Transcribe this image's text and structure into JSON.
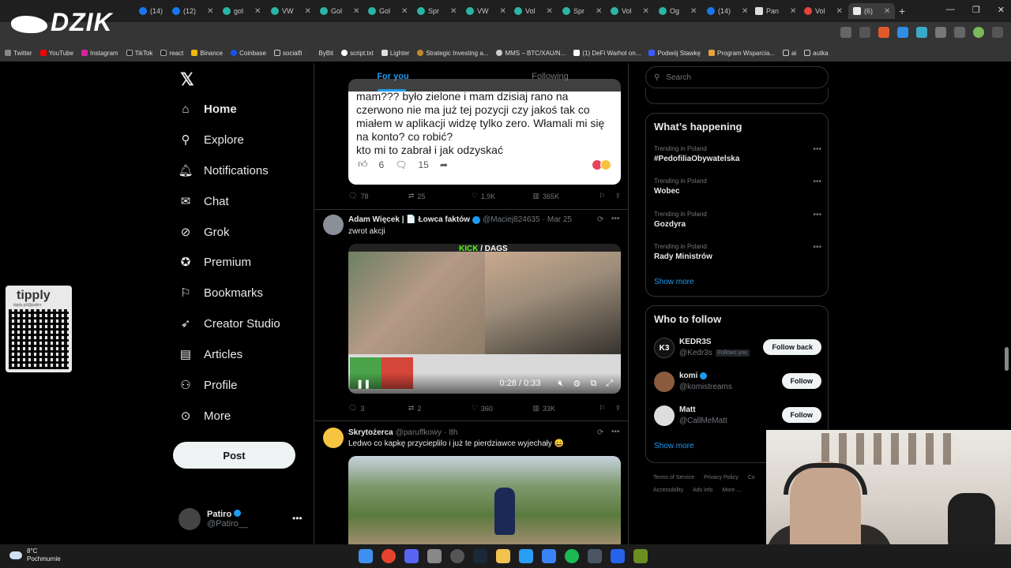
{
  "browser": {
    "tabs": [
      {
        "label": "(14)",
        "icon": "facebook-icon"
      },
      {
        "label": "(12)",
        "icon": "facebook-icon"
      },
      {
        "label": "gol",
        "icon": "site-icon"
      },
      {
        "label": "VW",
        "icon": "site-icon"
      },
      {
        "label": "Gol",
        "icon": "site-icon"
      },
      {
        "label": "Gol",
        "icon": "site-icon"
      },
      {
        "label": "Spr",
        "icon": "site-icon"
      },
      {
        "label": "VW",
        "icon": "site-icon"
      },
      {
        "label": "Vol",
        "icon": "site-icon"
      },
      {
        "label": "Spr",
        "icon": "site-icon"
      },
      {
        "label": "Vol",
        "icon": "site-icon"
      },
      {
        "label": "Og",
        "icon": "site-icon"
      },
      {
        "label": "(14)",
        "icon": "facebook-icon"
      },
      {
        "label": "Pan",
        "icon": "site-icon"
      },
      {
        "label": "Vol",
        "icon": "site-icon"
      },
      {
        "label": "(6)",
        "icon": "x-icon"
      }
    ],
    "bookmarks": [
      "Twitter",
      "YouTube",
      "Instagram",
      "TikTok",
      "react",
      "Binance",
      "Coinbase",
      "socialfi",
      "ByBit",
      "script.txt",
      "Lighter",
      "Strategic Investing a...",
      "MMS – BTC/XAU/N...",
      "(1) DeFi Warhol on...",
      "Podwój Stawkę",
      "Program Wsparcia...",
      "ai",
      "autka"
    ]
  },
  "overlay": {
    "logo_text": "DZIK",
    "tipply_title": "tipply",
    "tipply_url": "tipply.pl/@patiro"
  },
  "nav": {
    "items": [
      {
        "label": "Home",
        "icon": "home-icon"
      },
      {
        "label": "Explore",
        "icon": "search-icon"
      },
      {
        "label": "Notifications",
        "icon": "bell-icon"
      },
      {
        "label": "Chat",
        "icon": "mail-icon"
      },
      {
        "label": "Grok",
        "icon": "grok-icon"
      },
      {
        "label": "Premium",
        "icon": "premium-icon"
      },
      {
        "label": "Bookmarks",
        "icon": "bookmark-icon"
      },
      {
        "label": "Creator Studio",
        "icon": "rocket-icon"
      },
      {
        "label": "Articles",
        "icon": "article-icon"
      },
      {
        "label": "Profile",
        "icon": "person-icon"
      },
      {
        "label": "More",
        "icon": "more-circle-icon"
      }
    ],
    "post_label": "Post",
    "account": {
      "name": "Patiro",
      "handle": "@Patiro__"
    }
  },
  "feed": {
    "tabs": [
      "For you",
      "Following"
    ],
    "quote": {
      "text": "mam??? było zielone i mam dzisiaj rano na czerwono nie ma już tej pozycji czy jakoś tak co miałem w aplikacji widzę tylko zero. Włamali mi się na konto? co robić?\nkto mi to zabrał i jak odzyskać",
      "likes": "6",
      "comments": "15"
    },
    "posts": [
      {
        "replies": "78",
        "reposts": "25",
        "likes": "1,9K",
        "views": "365K"
      },
      {
        "author": "Adam Więcek | 📄 Łowca faktów",
        "handle": "@Maciej824635",
        "date": "Mar 25",
        "text": "zwrot akcji",
        "video_banner_a": "KICK",
        "video_banner_b": " / DAGS",
        "video_time": "0:28 / 0:33",
        "replies": "3",
        "reposts": "2",
        "likes": "360",
        "views": "33K"
      },
      {
        "author": "Skrytożerca",
        "handle": "@paruffkowy",
        "date": "8h",
        "text": "Ledwo co kapkę przycieplilo i już te pierdziawce wyjechały 😄"
      }
    ]
  },
  "sidebar": {
    "search_placeholder": "Search",
    "happening_title": "What’s happening",
    "trends": [
      {
        "context": "Trending in Poland",
        "name": "#PedofiliaObywatelska"
      },
      {
        "context": "Trending in Poland",
        "name": "Wobec"
      },
      {
        "context": "Trending in Poland",
        "name": "Gozdyra"
      },
      {
        "context": "Trending in Poland",
        "name": "Rady Ministrów"
      }
    ],
    "show_more": "Show more",
    "wtf_title": "Who to follow",
    "follow_suggestions": [
      {
        "name": "KEDR3S",
        "handle": "@Kedr3s",
        "badge": "Follows you",
        "button": "Follow back"
      },
      {
        "name": "komi",
        "handle": "@komistreams",
        "button": "Follow"
      },
      {
        "name": "Matt",
        "handle": "@CallMeMatt",
        "button": "Follow"
      }
    ],
    "footer": [
      "Terms of Service",
      "Privacy Policy",
      "Co",
      "Accessibility",
      "Ads info",
      "More ..."
    ]
  },
  "taskbar": {
    "temp": "8°C",
    "condition": "Pochmurnie"
  },
  "colors": {
    "accent": "#1d9bf0",
    "background": "#000000",
    "border": "#2f3336",
    "muted_text": "#71767b"
  }
}
